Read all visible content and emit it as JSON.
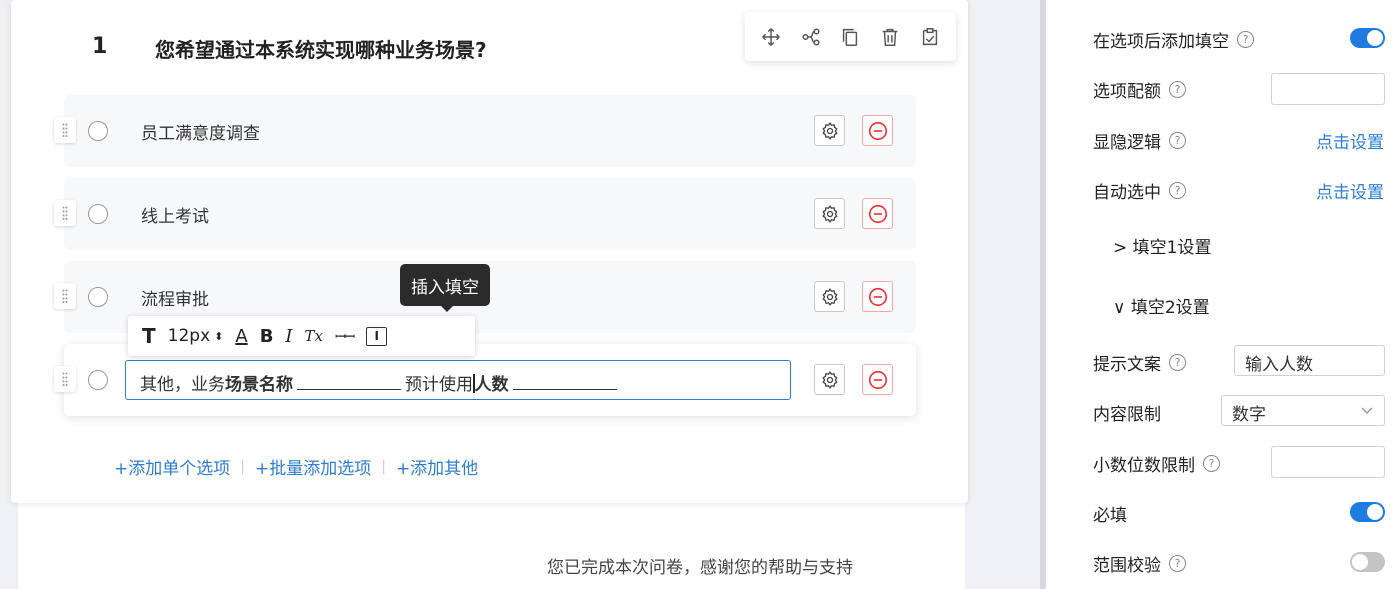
{
  "question": {
    "number": "1",
    "title": "您希望通过本系统实现哪种业务场景?",
    "toolbar_icons": [
      "move-icon",
      "logic-icon",
      "copy-icon",
      "trash-icon",
      "save-icon"
    ],
    "options": [
      {
        "label": "员工满意度调查"
      },
      {
        "label": "线上考试"
      },
      {
        "label": "流程审批"
      }
    ],
    "active_option": {
      "text_prefix": "其他，业务",
      "text_bold_1": "场景名称",
      "text_mid": "预计使用",
      "text_bold_2": "人数"
    },
    "format_toolbar": {
      "text_icon": "T",
      "font_size": "12px",
      "font_color_icon": "A",
      "bold": "B",
      "italic": "I",
      "clear_format_icon": "Tx",
      "underline_blank_icon": "ꟷꟷ",
      "insert_blank_icon": "I"
    },
    "tooltip": "插入填空",
    "add_links": {
      "add_single": "+添加单个选项",
      "add_batch": "+批量添加选项",
      "add_other": "+添加其他"
    }
  },
  "thanks_text": "您已完成本次问卷，感谢您的帮助与支持",
  "settings": {
    "add_blank_after": {
      "label": "在选项后添加填空",
      "on": true
    },
    "option_quota": {
      "label": "选项配额",
      "value": ""
    },
    "visibility_logic": {
      "label": "显隐逻辑",
      "link": "点击设置"
    },
    "auto_select": {
      "label": "自动选中",
      "link": "点击设置"
    },
    "blank1_section": {
      "label": "> 填空1设置"
    },
    "blank2_section": {
      "label": "∨ 填空2设置"
    },
    "hint_text": {
      "label": "提示文案",
      "value": "输入人数"
    },
    "content_limit": {
      "label": "内容限制",
      "value": "数字"
    },
    "decimal_limit": {
      "label": "小数位数限制",
      "value": ""
    },
    "required": {
      "label": "必填",
      "on": true
    },
    "range_check": {
      "label": "范围校验",
      "on": false
    }
  }
}
